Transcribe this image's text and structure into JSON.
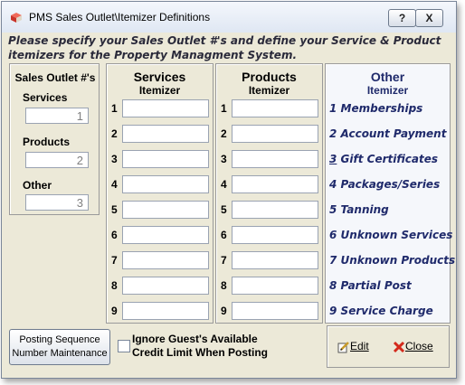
{
  "window": {
    "title": "PMS Sales Outlet\\Itemizer Definitions",
    "help_label": "?",
    "close_label": "X"
  },
  "instructions": "Please specify your Sales Outlet #'s and define your Service & Product itemizers for the Property Managment System.",
  "outlets": {
    "title": "Sales Outlet #'s",
    "services_label": "Services",
    "services_value": "1",
    "products_label": "Products",
    "products_value": "2",
    "other_label": "Other",
    "other_value": "3"
  },
  "services": {
    "title": "Services",
    "subtitle": "Itemizer"
  },
  "products": {
    "title": "Products",
    "subtitle": "Itemizer"
  },
  "other": {
    "title": "Other",
    "subtitle": "Itemizer",
    "items": [
      {
        "num": "1",
        "label": "Memberships"
      },
      {
        "num": "2",
        "label": "Account Payment"
      },
      {
        "num": "3",
        "label": "Gift Certificates"
      },
      {
        "num": "4",
        "label": "Packages/Series"
      },
      {
        "num": "5",
        "label": "Tanning"
      },
      {
        "num": "6",
        "label": "Unknown Services"
      },
      {
        "num": "7",
        "label": "Unknown Products"
      },
      {
        "num": "8",
        "label": "Partial Post"
      },
      {
        "num": "9",
        "label": "Service Charge"
      }
    ]
  },
  "row_numbers": [
    "1",
    "2",
    "3",
    "4",
    "5",
    "6",
    "7",
    "8",
    "9"
  ],
  "footer": {
    "posting_line1": "Posting Sequence",
    "posting_line2": "Number Maintenance",
    "credit_line1": "Ignore Guest's Available",
    "credit_line2": "Credit Limit When Posting",
    "edit_label": "Edit",
    "close_label": "Close"
  },
  "colors": {
    "accent_text": "#1f2a6b",
    "window_bg": "#ece9d8"
  },
  "icons": [
    "window-app-icon",
    "pencil-edit-icon",
    "red-x-close-icon"
  ]
}
